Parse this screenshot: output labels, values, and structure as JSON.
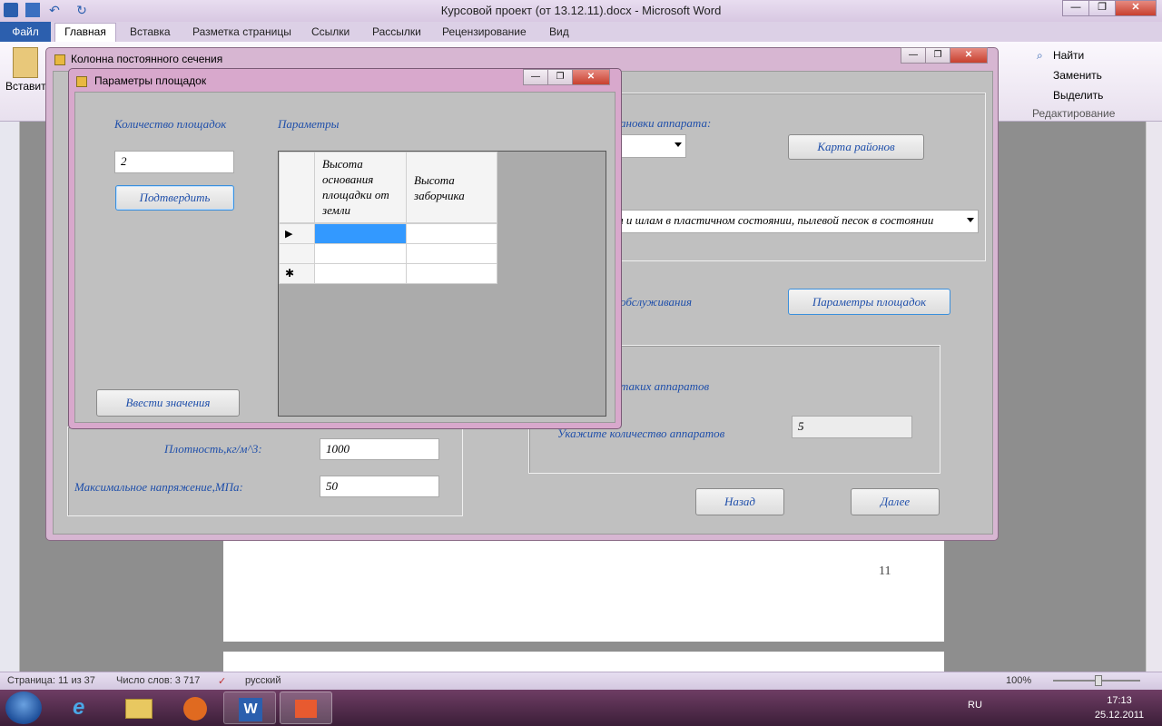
{
  "word": {
    "title": "Курсовой проект (от 13.12.11).docx - Microsoft Word",
    "file_tab": "Файл",
    "tabs": [
      "Главная",
      "Вставка",
      "Разметка страницы",
      "Ссылки",
      "Рассылки",
      "Рецензирование",
      "Вид"
    ],
    "paste_label": "Вставить",
    "edit_group": {
      "find": "Найти",
      "replace": "Заменить",
      "select": "Выделить",
      "label": "Редактирование"
    },
    "page_number": "11",
    "status": {
      "page": "Страница: 11 из 37",
      "words": "Число слов: 3 717",
      "lang": "русский",
      "zoom": "100%"
    }
  },
  "form1": {
    "title": "Колонна постоянного сечения",
    "install_label": "ановки аппарата:",
    "map_button": "Карта районов",
    "soil_combo": "л и шлам в пластичном состоянии, пылевой песок в состоянии",
    "service_label": "обслуживания",
    "platforms_button": "Параметры площадок",
    "same_label": "таких аппаратов",
    "count_label": "Укажите количество аппаратов",
    "count_value": "5",
    "density_label": "Плотность,кг/м^3:",
    "density_value": "1000",
    "stress_label": "Максимальное напряжение,МПа:",
    "stress_value": "50",
    "back_button": "Назад",
    "next_button": "Далее"
  },
  "dialog": {
    "title": "Параметры площадок",
    "count_label": "Количество площадок",
    "count_value": "2",
    "confirm_button": "Подтвердить",
    "params_label": "Параметры",
    "columns": [
      "Высота основания площадки от земли",
      "Высота заборчика"
    ],
    "row_markers": [
      "▶",
      "",
      "✱"
    ],
    "enter_button": "Ввести значения"
  },
  "taskbar": {
    "lang": "RU",
    "time": "17:13",
    "date": "25.12.2011"
  }
}
